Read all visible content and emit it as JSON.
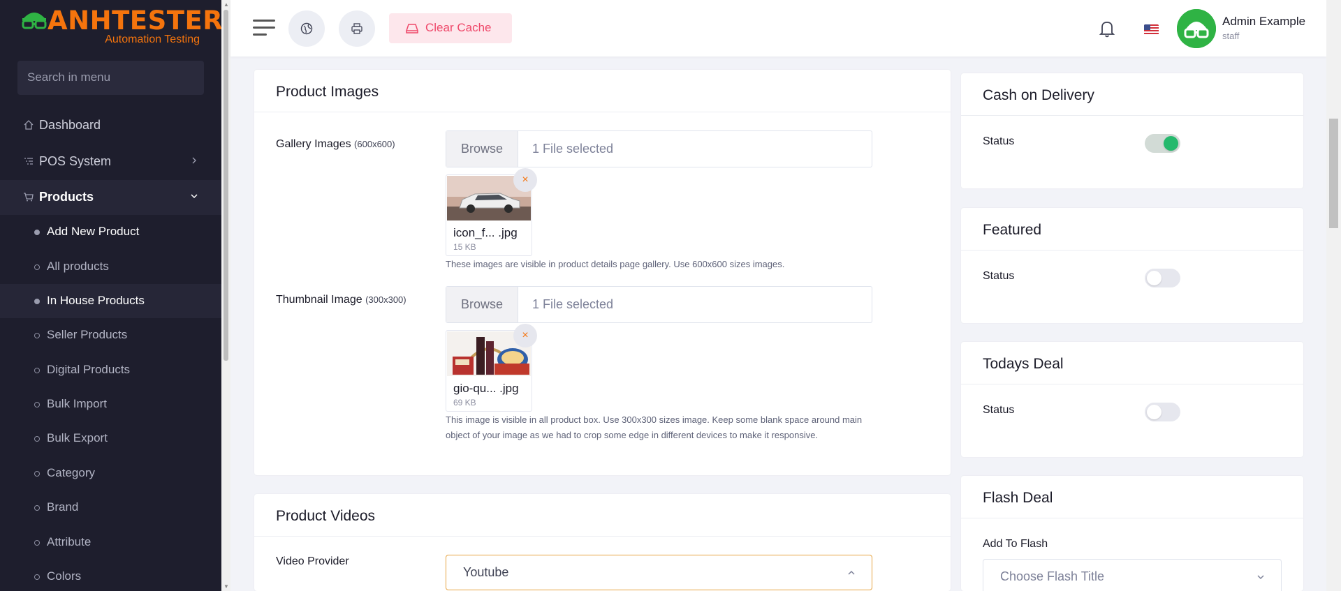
{
  "brand": {
    "name": "ANHTESTER",
    "tagline": "Automation Testing"
  },
  "sidebar": {
    "search_placeholder": "Search in menu",
    "items": [
      {
        "label": "Dashboard",
        "icon": "home-icon"
      },
      {
        "label": "POS System",
        "icon": "list-icon"
      },
      {
        "label": "Products",
        "icon": "cart-icon"
      }
    ],
    "sub_items": [
      {
        "label": "Add New Product"
      },
      {
        "label": "All products"
      },
      {
        "label": "In House Products"
      },
      {
        "label": "Seller Products"
      },
      {
        "label": "Digital Products"
      },
      {
        "label": "Bulk Import"
      },
      {
        "label": "Bulk Export"
      },
      {
        "label": "Category"
      },
      {
        "label": "Brand"
      },
      {
        "label": "Attribute"
      },
      {
        "label": "Colors"
      }
    ]
  },
  "header": {
    "clear_cache_label": "Clear Cache",
    "user_name": "Admin Example",
    "user_role": "staff"
  },
  "product_images": {
    "title": "Product Images",
    "gallery": {
      "label": "Gallery Images",
      "size_hint": "(600x600)",
      "browse_label": "Browse",
      "selected_text": "1 File selected",
      "file_name": "icon_f... .jpg",
      "file_size": "15 KB",
      "remove_label": "×",
      "help_text": "These images are visible in product details page gallery. Use 600x600 sizes images."
    },
    "thumbnail": {
      "label": "Thumbnail Image",
      "size_hint": "(300x300)",
      "browse_label": "Browse",
      "selected_text": "1 File selected",
      "file_name": "gio-qu... .jpg",
      "file_size": "69 KB",
      "remove_label": "×",
      "help_text_1": "This image is visible in all product box. Use 300x300 sizes image. Keep some blank space around main",
      "help_text_2": "object of your image as we had to crop some edge in different devices to make it responsive."
    }
  },
  "product_videos": {
    "title": "Product Videos",
    "provider_label": "Video Provider",
    "provider_value": "Youtube"
  },
  "cash_on_delivery": {
    "title": "Cash on Delivery",
    "status_label": "Status",
    "enabled": true
  },
  "featured": {
    "title": "Featured",
    "status_label": "Status",
    "enabled": false
  },
  "todays_deal": {
    "title": "Todays Deal",
    "status_label": "Status",
    "enabled": false
  },
  "flash_deal": {
    "title": "Flash Deal",
    "add_label": "Add To Flash",
    "placeholder": "Choose Flash Title"
  },
  "colors": {
    "accent": "#f5740d",
    "sidebar_bg": "#1e1e2d",
    "toggle_on": "#25b96d",
    "cache_text": "#ef486a",
    "avatar": "#2fb344"
  }
}
